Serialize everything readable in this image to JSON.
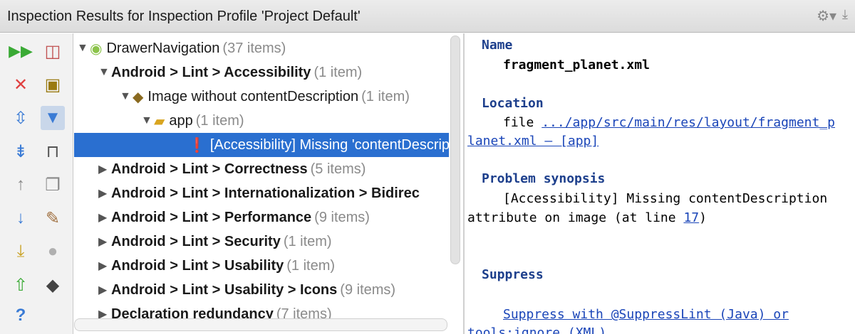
{
  "window": {
    "title": "Inspection Results for Inspection Profile 'Project Default'"
  },
  "toolbar": {
    "icons": [
      "run-icon",
      "close-icon",
      "expand-all-icon",
      "collapse-all-icon",
      "up-icon",
      "down-icon",
      "export-icon",
      "import-icon",
      "help-icon",
      "group-icon",
      "module-icon",
      "filter-icon",
      "autoscroll-icon",
      "copy-icon",
      "settings-icon",
      "bulb-icon",
      "spy-icon"
    ]
  },
  "tree": {
    "root": {
      "label": "DrawerNavigation",
      "count": "(37 items)"
    },
    "items": [
      {
        "label": "Android > Lint > Accessibility",
        "count": "(1 item)"
      },
      {
        "label": "Image without contentDescription",
        "count": "(1 item)"
      },
      {
        "label": "app",
        "count": "(1 item)"
      },
      {
        "label": "[Accessibility] Missing 'contentDescrip"
      },
      {
        "label": "Android > Lint > Correctness",
        "count": "(5 items)"
      },
      {
        "label": "Android > Lint > Internationalization > Bidirec"
      },
      {
        "label": "Android > Lint > Performance",
        "count": "(9 items)"
      },
      {
        "label": "Android > Lint > Security",
        "count": "(1 item)"
      },
      {
        "label": "Android > Lint > Usability",
        "count": "(1 item)"
      },
      {
        "label": "Android > Lint > Usability > Icons",
        "count": "(9 items)"
      },
      {
        "label": "Declaration redundancy",
        "count": "(7 items)"
      }
    ]
  },
  "detail": {
    "name_heading": "Name",
    "name_value": "fragment_planet.xml",
    "location_heading": "Location",
    "location_prefix": "file",
    "location_link_1": ".../app/src/main/res/layout/fragment_p",
    "location_link_2": "lanet.xml – [app]",
    "synopsis_heading": "Problem synopsis",
    "synopsis_line_1": "[Accessibility] Missing contentDescription",
    "synopsis_line_2": "attribute on image (at line",
    "synopsis_line_num": "17",
    "synopsis_line_end": ")",
    "suppress_heading": "Suppress",
    "suppress_link_1": "Suppress with @SuppressLint (Java) or",
    "suppress_link_2": "tools:ignore (XML)"
  }
}
